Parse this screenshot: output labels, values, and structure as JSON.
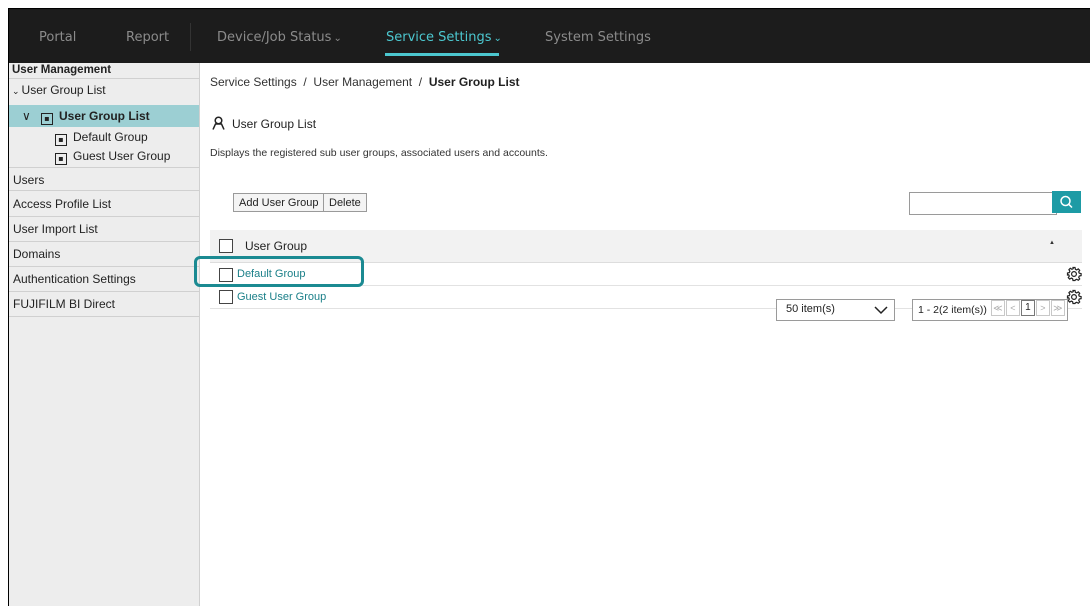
{
  "topnav": {
    "items": [
      {
        "label": "Portal",
        "active": false
      },
      {
        "label": "Report",
        "active": false
      },
      {
        "label": "Device/Job Status",
        "active": false,
        "dropdown": true
      },
      {
        "label": "Service Settings",
        "active": true,
        "dropdown": true
      },
      {
        "label": "System Settings",
        "active": false
      }
    ],
    "accent_color": "#4cc7cf"
  },
  "sidebar": {
    "section_title": "User Management",
    "tree_root": "User Group List",
    "selected_node": "User Group List",
    "children": [
      "Default Group",
      "Guest User Group"
    ],
    "items": [
      "Users",
      "Access Profile List",
      "User Import List",
      "Domains",
      "Authentication Settings",
      "FUJIFILM BI Direct"
    ],
    "selected_color": "#9ccfd3"
  },
  "breadcrumb": {
    "part1": "Service Settings",
    "sep": "/",
    "part2": "User Management",
    "current": "User Group List"
  },
  "page": {
    "title": "User Group List",
    "description": "Displays the registered sub user groups, associated users and accounts."
  },
  "toolbar": {
    "add_label": "Add User Group",
    "delete_label": "Delete",
    "search_value": ""
  },
  "table": {
    "column": "User Group",
    "sort_indicator": "▲",
    "rows": [
      "Default Group",
      "Guest User Group"
    ],
    "link_color": "#1a7f88"
  },
  "pagination": {
    "per_page": "50 item(s)",
    "range": "1 - 2(2 item(s))",
    "first": "≪",
    "prev": "<",
    "page": "1",
    "next": ">",
    "last": "≫"
  }
}
